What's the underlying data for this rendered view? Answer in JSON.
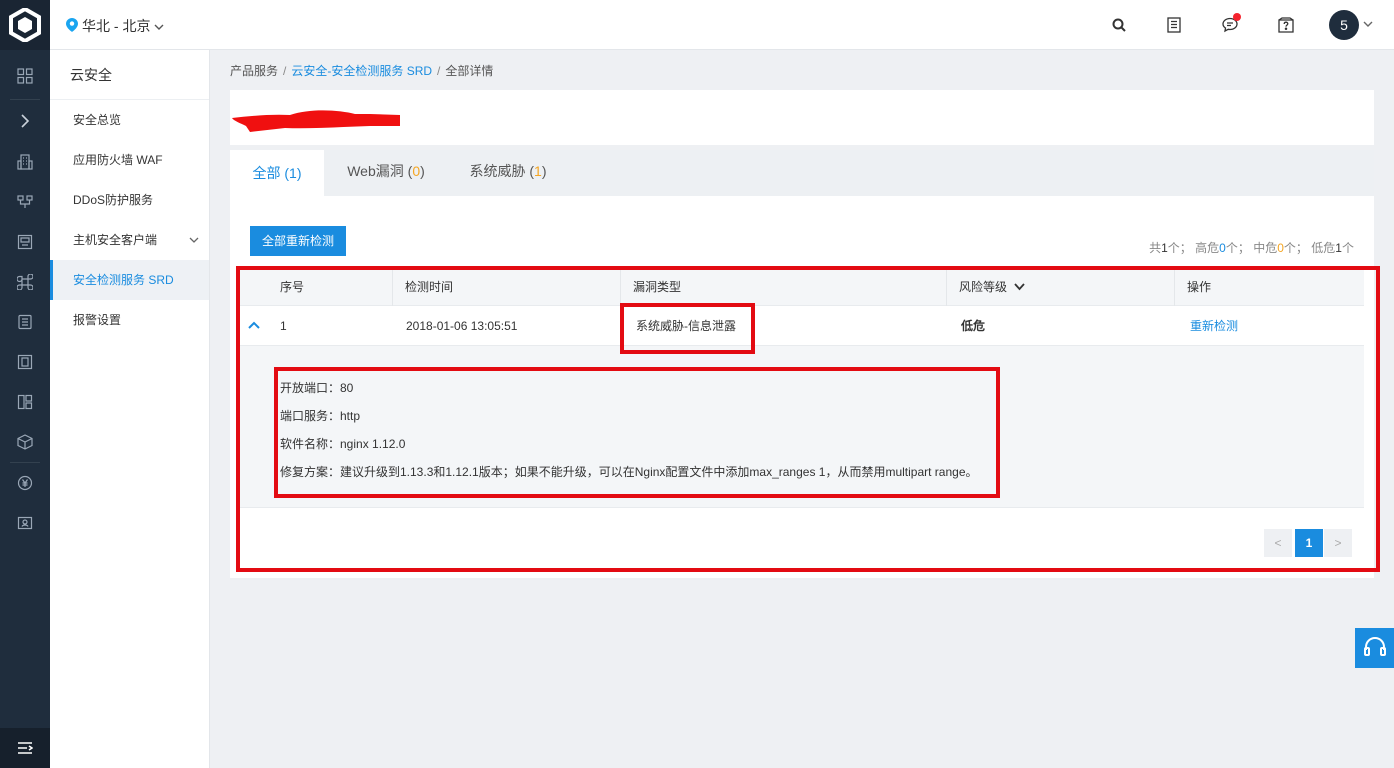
{
  "topbar": {
    "region": "华北 - 北京",
    "avatar_label": "5",
    "icons": [
      "search-icon",
      "document-icon",
      "message-icon",
      "help-icon"
    ]
  },
  "sidebar": {
    "title": "云安全",
    "items": [
      {
        "label": "安全总览"
      },
      {
        "label": "应用防火墙 WAF"
      },
      {
        "label": "DDoS防护服务"
      },
      {
        "label": "主机安全客户端"
      },
      {
        "label": "安全检测服务 SRD"
      },
      {
        "label": "报警设置"
      }
    ]
  },
  "breadcrumb": {
    "root": "产品服务",
    "sep": "/",
    "parent": "云安全-安全检测服务 SRD",
    "current": "全部详情"
  },
  "tabs": [
    {
      "label": "全部",
      "count": "1"
    },
    {
      "label": "Web漏洞",
      "count": "0"
    },
    {
      "label": "系统威胁",
      "count": "1"
    }
  ],
  "toolbar": {
    "recheck_all": "全部重新检测"
  },
  "summary": {
    "total_prefix": "共",
    "total": "1",
    "total_suffix": "个；",
    "high_prefix": "高危",
    "high": "0",
    "high_suffix": "个；",
    "mid_prefix": "中危",
    "mid": "0",
    "mid_suffix": "个；",
    "low_prefix": "低危",
    "low": "1",
    "low_suffix": "个"
  },
  "table": {
    "columns": [
      "序号",
      "检测时间",
      "漏洞类型",
      "风险等级",
      "操作"
    ],
    "rows": [
      {
        "index": "1",
        "time": "2018-01-06 13:05:51",
        "type": "系统威胁-信息泄露",
        "risk": "低危",
        "action": "重新检测"
      }
    ]
  },
  "detail": {
    "port": "开放端口：80",
    "service": "端口服务：http",
    "software": "软件名称：nginx 1.12.0",
    "fix": "修复方案：建议升级到1.13.3和1.12.1版本；如果不能升级，可以在Nginx配置文件中添加max_ranges 1，从而禁用multipart range。"
  },
  "pagination": {
    "prev": "<",
    "current": "1",
    "next": ">"
  },
  "colors": {
    "accent": "#1a8cdf",
    "annotation_red": "#e30b12",
    "count_orange": "#f5a623",
    "rail": "#1f2d3d"
  }
}
